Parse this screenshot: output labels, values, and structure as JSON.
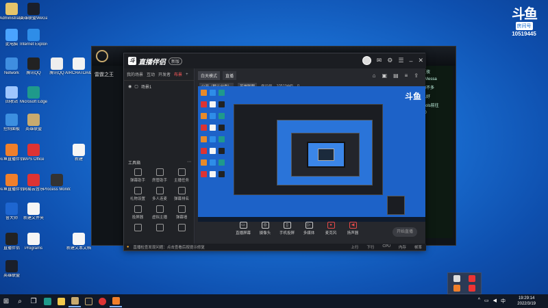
{
  "desktop_icons": [
    {
      "label": "Administrator",
      "color": "#e5c46a"
    },
    {
      "label": "英雄联盟WeGame版",
      "color": "#1a1f2a"
    },
    {
      "label": "此电脑",
      "color": "#4aa3ff"
    },
    {
      "label": "Internet Explorer",
      "color": "#2e8de8"
    },
    {
      "label": "Network",
      "color": "#3f8ee0"
    },
    {
      "label": "腾讯QQ",
      "color": "#222"
    },
    {
      "label": "腾讯QQ",
      "color": "#eee"
    },
    {
      "label": "AIRCHATDAILY",
      "color": "#f2f2f2"
    },
    {
      "label": "回收站",
      "color": "#9ec6ff"
    },
    {
      "label": "Microsoft Edge",
      "color": "#1f9a8b"
    },
    {
      "label": "控制面板",
      "color": "#3c8fe0"
    },
    {
      "label": "英雄联盟",
      "color": "#c8aa6e"
    },
    {
      "label": "斗鱼直播伴侣",
      "color": "#f07f2a"
    },
    {
      "label": "WPS Office",
      "color": "#d33"
    },
    {
      "label": "新建",
      "color": "#f5f5f5"
    },
    {
      "label": "斗鱼直播伴侣",
      "color": "#f07f2a"
    },
    {
      "label": "网易云音乐",
      "color": "#d33"
    },
    {
      "label": "Process Monitor",
      "color": "#333"
    },
    {
      "label": "鲁大师",
      "color": "#1e66d0"
    },
    {
      "label": "新建文件夹",
      "color": "#f5f5f5"
    },
    {
      "label": "直播伴侣",
      "color": "#222"
    },
    {
      "label": "Programs",
      "color": "#f5f5f5"
    },
    {
      "label": "新建文本文档",
      "color": "#f5f5f5"
    },
    {
      "label": "英雄联盟",
      "color": "#1a1f2a"
    }
  ],
  "watermark": {
    "logo": "斗鱼",
    "badge": "房间号",
    "room": "10519445"
  },
  "game": {
    "title_left": "雷霆之王",
    "coins": "3850",
    "right_lines": [
      "夏夜",
      "XMessa",
      "的不多",
      "么好",
      "tools前往",
      "10"
    ]
  },
  "app": {
    "title": "直播伴侣",
    "version": "新版",
    "left_tabs": [
      "我的场景",
      "互动",
      "开发者",
      "布景"
    ],
    "scene": "场景1",
    "toolbox_label": "工具箱",
    "tools": [
      "弹幕助手",
      "房管助手",
      "主播任务",
      "礼物设置",
      "多人连麦",
      "弹幕排名",
      "投屏器",
      "虚拟主播",
      "弹幕墙",
      "",
      "",
      ""
    ],
    "center_tabs": [
      "白天模式",
      "直播"
    ],
    "info_tags": [
      "公开（默认分类）",
      "英雄联盟"
    ],
    "info_room": "房间号",
    "info_id": "10519445",
    "info_count": "0",
    "controls": [
      "直播屏幕",
      "摄像头",
      "手机投屏",
      "多媒体",
      "麦克风",
      "扬声器"
    ],
    "start_label": "开始直播",
    "status_warn": "直播检查发现问题：点击查看后按提示修复",
    "status_right": [
      "上行",
      "下行",
      "CPU",
      "内存",
      "帧率"
    ],
    "preview_watermark": "斗鱼"
  },
  "taskbar": {
    "time": "19:29:14",
    "date": "2022/3/19",
    "lang": "中"
  }
}
